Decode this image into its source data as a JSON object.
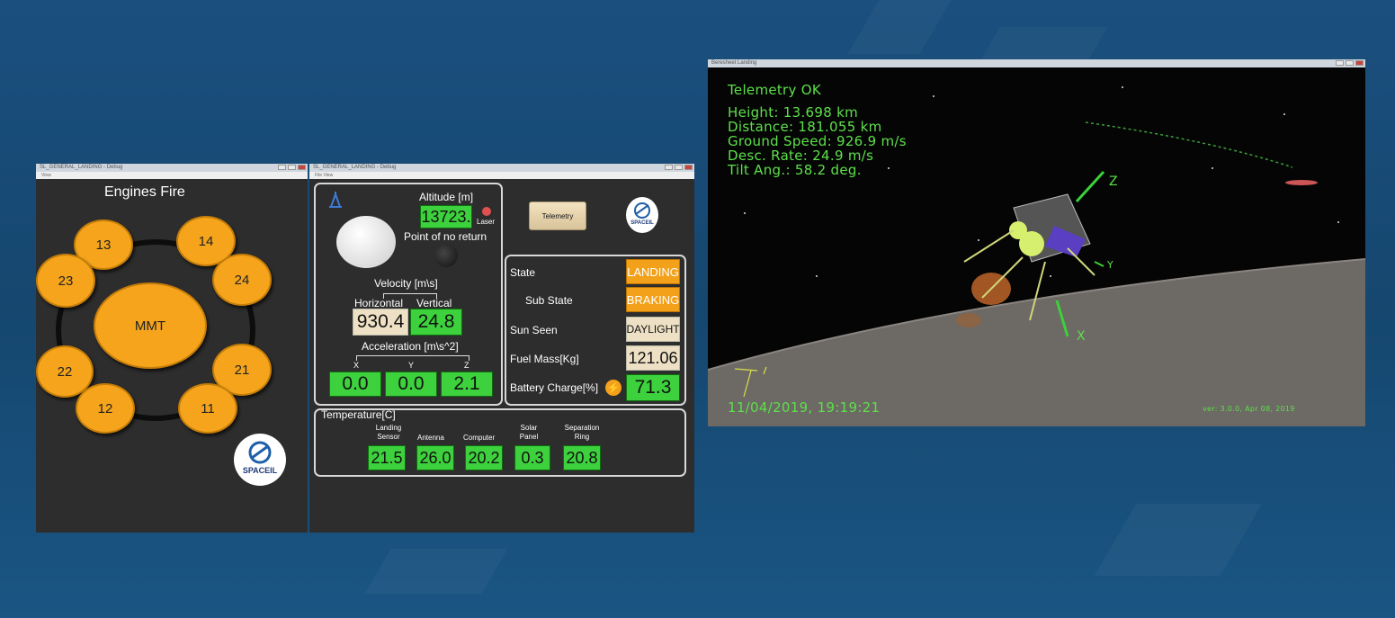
{
  "engines_window": {
    "title": "SL_GENERAL_LANDING - Debug",
    "menu": "View",
    "heading": "Engines Fire",
    "main_engine": "MMT",
    "engines": [
      "13",
      "14",
      "23",
      "24",
      "22",
      "21",
      "12",
      "11"
    ],
    "logo": "SPACEIL"
  },
  "landing_window": {
    "title": "SL_GENERAL_LANDING - Debug",
    "menu": "File   View",
    "altitude_label": "Altitude [m]",
    "altitude_value": "13723.",
    "laser_label": "Laser",
    "pnr_label": "Point of no return",
    "telemetry_button": "Telemetry",
    "logo": "SPACEIL",
    "velocity_label": "Velocity [m\\s]",
    "horizontal_label": "Horizontal",
    "vertical_label": "Vertical",
    "horizontal_value": "930.4",
    "vertical_value": "24.8",
    "acceleration_label": "Acceleration [m\\s^2]",
    "accel_axes": [
      "X",
      "Y",
      "Z"
    ],
    "accel_values": [
      "0.0",
      "0.0",
      "2.1"
    ],
    "status": {
      "state_label": "State",
      "state_value": "LANDING",
      "substate_label": "Sub State",
      "substate_value": "BRAKING",
      "sun_label": "Sun Seen",
      "sun_value": "DAYLIGHT",
      "fuel_label": "Fuel Mass[Kg]",
      "fuel_value": "121.06",
      "battery_label": "Battery Charge[%]",
      "battery_value": "71.3"
    },
    "temperature": {
      "label": "Temperature[C]",
      "sensors": [
        {
          "name": "Landing Sensor",
          "value": "21.5"
        },
        {
          "name": "Antenna",
          "value": "26.0"
        },
        {
          "name": "Computer",
          "value": "20.2"
        },
        {
          "name": "Solar Panel",
          "value": "0.3"
        },
        {
          "name": "Separation Ring",
          "value": "20.8"
        }
      ]
    }
  },
  "sim_window": {
    "title": "Beresheet Landing",
    "telemetry_status": "Telemetry OK",
    "height": "Height: 13.698 km",
    "distance": "Distance: 181.055 km",
    "ground_speed": "Ground Speed:  926.9 m/s",
    "desc_rate": "Desc. Rate:   24.9 m/s",
    "tilt": "Tilt Ang.:   58.2 deg.",
    "datetime": "11/04/2019, 19:19:21",
    "version": "ver: 3.0.0, Apr 08, 2019",
    "axis_labels": [
      "Z",
      "Y",
      "X"
    ]
  },
  "colors": {
    "green": "#3dd13d",
    "orange": "#f3a11b",
    "cream": "#ede0c4",
    "telemetry_text": "#5de04a"
  }
}
